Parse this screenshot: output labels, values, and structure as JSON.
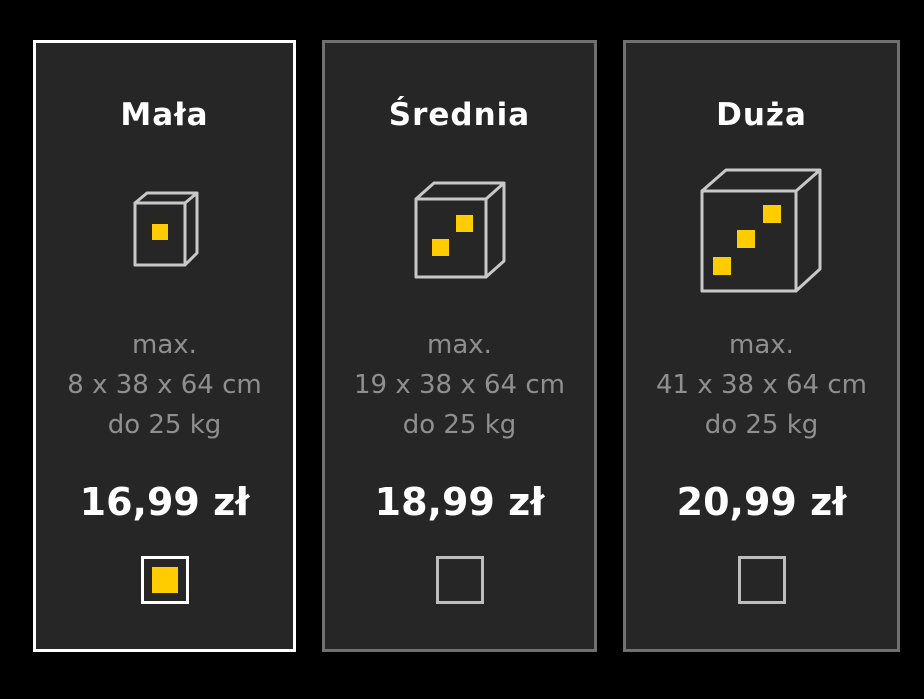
{
  "colors": {
    "background": "#000000",
    "card_background": "#262626",
    "card_border": "#707070",
    "selected_border": "#ffffff",
    "accent": "#ffcc00",
    "box_outline": "#c8c8c8",
    "spec_text": "#8f8f8f"
  },
  "options": [
    {
      "title": "Mała",
      "spec_prefix": "max.",
      "dimensions": "8 x 38 x 64 cm",
      "weight": "do 25 kg",
      "price": "16,99 zł",
      "selected": true,
      "icon": "small-box-icon"
    },
    {
      "title": "Średnia",
      "spec_prefix": "max.",
      "dimensions": "19 x 38 x 64 cm",
      "weight": "do 25 kg",
      "price": "18,99 zł",
      "selected": false,
      "icon": "medium-box-icon"
    },
    {
      "title": "Duża",
      "spec_prefix": "max.",
      "dimensions": "41 x 38 x 64 cm",
      "weight": "do 25 kg",
      "price": "20,99 zł",
      "selected": false,
      "icon": "large-box-icon"
    }
  ]
}
